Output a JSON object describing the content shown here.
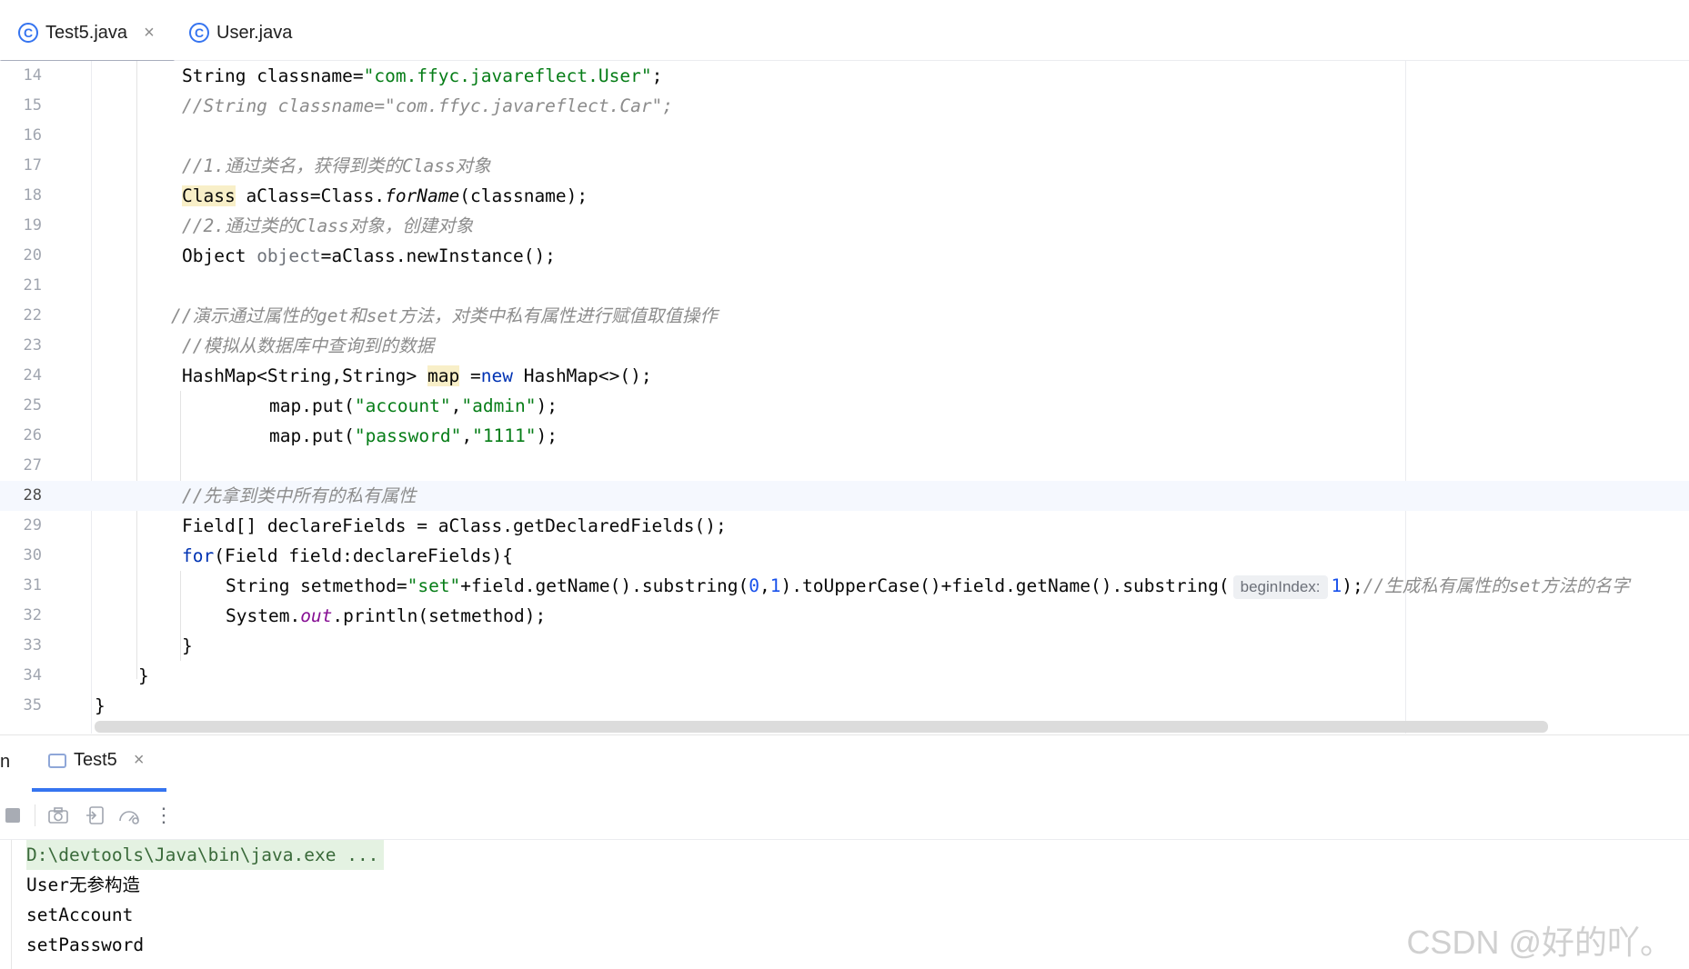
{
  "tabs": [
    {
      "label": "Test5.java",
      "icon": "class-icon",
      "active": true,
      "close": "×"
    },
    {
      "label": "User.java",
      "icon": "class-icon",
      "active": false
    }
  ],
  "editor": {
    "line_numbers": [
      "14",
      "15",
      "16",
      "17",
      "18",
      "19",
      "20",
      "21",
      "22",
      "23",
      "24",
      "25",
      "26",
      "27",
      "28",
      "29",
      "30",
      "31",
      "32",
      "33",
      "34",
      "35"
    ],
    "current_line": "28",
    "lines": {
      "l14": {
        "a": "String ",
        "b": "classname",
        "c": "=",
        "d": "\"com.ffyc.javareflect.User\"",
        "e": ";"
      },
      "l15": {
        "a": "//String classname=\"com.ffyc.javareflect.Car\";"
      },
      "l17": {
        "a": "//1.通过类名，获得到类的Class对象"
      },
      "l18": {
        "a": "Class",
        "b": " aClass=Class.",
        "c": "forName",
        "d": "(classname);"
      },
      "l19": {
        "a": "//2.通过类的Class对象，创建对象"
      },
      "l20": {
        "a": "Object ",
        "b": "object",
        "c": "=aClass.newInstance();"
      },
      "l22": {
        "a": "//演示通过属性的get和set方法，对类中私有属性进行赋值取值操作"
      },
      "l23": {
        "a": "//模拟从数据库中查询到的数据"
      },
      "l24": {
        "a": "HashMap<String,String> ",
        "b": "map",
        "c": " =",
        "d": "new",
        "e": " HashMap<>();"
      },
      "l25": {
        "a": "map.put(",
        "b": "\"account\"",
        "c": ",",
        "d": "\"admin\"",
        "e": ");"
      },
      "l26": {
        "a": "map.put(",
        "b": "\"password\"",
        "c": ",",
        "d": "\"1111\"",
        "e": ");"
      },
      "l28": {
        "a": "//先拿到类中所有的私有属性"
      },
      "l29": {
        "a": "Field[] declareFields = aClass.getDeclaredFields();"
      },
      "l30": {
        "a": "for",
        "b": "(Field field:declareFields){"
      },
      "l31": {
        "a": "String setmethod=",
        "b": "\"set\"",
        "c": "+field.getName().substring(",
        "d": "0",
        "e": ",",
        "f": "1",
        "g": ").toUpperCase()+field.getName().substring(",
        "hint": "beginIndex:",
        "h": "1",
        "i": ");",
        "j": "//生成私有属性的set方法的名字"
      },
      "l32": {
        "a": "System.",
        "b": "out",
        "c": ".println(setmethod);"
      },
      "l33": {
        "a": "}"
      },
      "l34": {
        "a": "}"
      },
      "l35": {
        "a": "}"
      }
    }
  },
  "run_panel": {
    "left_label": "n",
    "tab_label": "Test5",
    "tab_close": "×",
    "toolbar_icons": [
      "stop-icon",
      "camera-icon",
      "restore-layout-icon",
      "profiler-icon",
      "more-icon"
    ],
    "more_glyph": "⋮",
    "console_lines": [
      "D:\\devtools\\Java\\bin\\java.exe ...",
      "User无参构造",
      "setAccount",
      "setPassword"
    ]
  },
  "watermark": "CSDN @好的吖。"
}
